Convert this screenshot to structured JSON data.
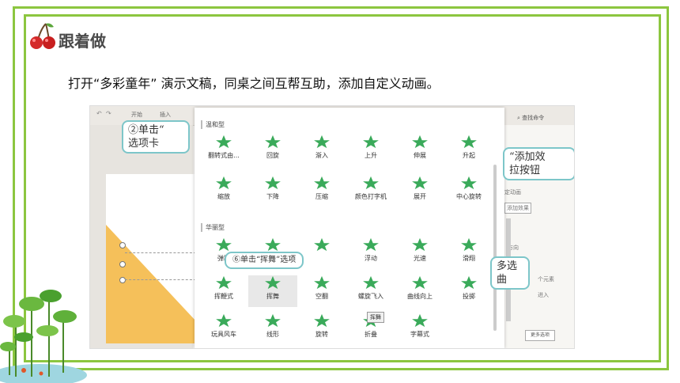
{
  "header": {
    "title": "跟着做",
    "instruction": "打开“多彩童年” 演示文稿，同桌之间互帮互助，添加自定义动画。"
  },
  "colors": {
    "frame": "#8cc63f",
    "star": "#3aaa5a",
    "callout_border": "#7dc6c9",
    "slide_shape": "#f5c05a"
  },
  "screenshot": {
    "ribbon": {
      "tab_start": "开始",
      "tab_insert": "插入",
      "search": "查找命令"
    },
    "callouts": {
      "step2_line1": "②单击“",
      "step2_line2": "选项卡",
      "add_effect_line1": "“添加效",
      "add_effect_line2": "拉按钮",
      "multi_select_line1": "多选",
      "multi_select_line2": "曲",
      "step6": "⑥单击“挥舞”选项"
    },
    "right_pane": {
      "line1": "定动画",
      "line2": "添加效果",
      "line3": "方向",
      "line4": "个元素",
      "line5": "进入",
      "more_button": "更多选项"
    },
    "tooltip": "挥舞",
    "gallery": {
      "section1": "温和型",
      "row1": [
        "翻转式由...",
        "回旋",
        "渐入",
        "上升",
        "伸展",
        "升起"
      ],
      "row2": [
        "缩放",
        "下降",
        "压缩",
        "颜色打字机",
        "展开",
        "中心旋转"
      ],
      "section2": "华丽型",
      "row3": [
        "弹跳",
        "",
        "",
        "浮动",
        "光速",
        "滑翔"
      ],
      "row4": [
        "挥鞭式",
        "挥舞",
        "空翻",
        "螺旋飞入",
        "曲线向上",
        "投掷"
      ],
      "row5": [
        "玩具风车",
        "线形",
        "旋转",
        "折叠",
        "字幕式"
      ]
    }
  }
}
